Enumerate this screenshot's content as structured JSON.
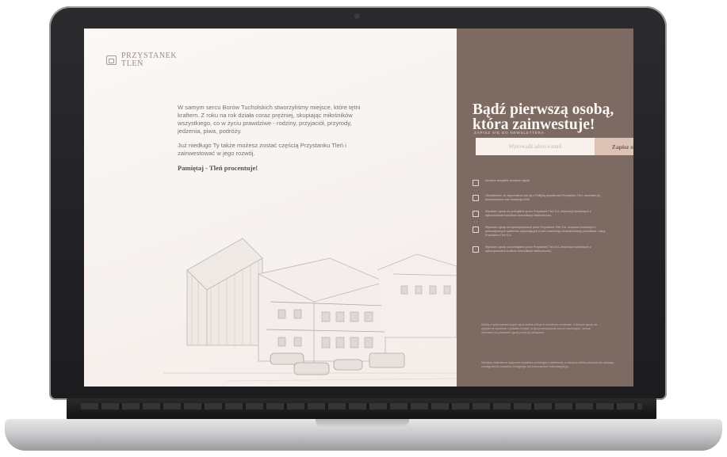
{
  "brand": {
    "name_line1": "PRZYSTANEK",
    "name_line2": "TLEŃ",
    "icon": "building-icon"
  },
  "intro": {
    "paragraph1": "W samym sercu Borów Tucholskich stworzyliśmy miejsce, które tętni kraftem. Z roku na rok działa coraz prężniej, skupiając miłośników wszystkiego, co w życiu prawdziwe - rodziny, przyjaciół, przyrody, jedzenia, piwa, podróży.",
    "paragraph2": "Już niedługo Ty także możesz zostać częścią Przystanku Tleń i zainwestować w jego rozwój.",
    "motto": "Pamiętaj - Tleń procentuje!"
  },
  "newsletter": {
    "headline_line1": "Bądź pierwszą osobą,",
    "headline_line2": "która zainwestuje!",
    "subheading": "ZAPISZ SIĘ DO NEWSLETTERA",
    "email_placeholder": "Wprowadź adres e-mail",
    "email_value": "",
    "submit_label": "Zapisz się!"
  },
  "consents": [
    {
      "text": "Zaznacz wszystkie poniższe zgody.",
      "checked": false
    },
    {
      "text": "Oświadczam, że zapoznałem/-am się z Polityką prywatności Przystanku Tleń, rozumiem jej postanowienia oraz akceptuję treść.",
      "checked": false
    },
    {
      "text": "Wyrażam zgodę na przesyłanie przez Przystanek Tleń S.A. informacji handlowych z wykorzystaniem środków komunikacji elektronicznej.",
      "checked": false
    },
    {
      "text": "Wyrażam zgodę na wykorzystywanie przez Przystanek Tleń S.A. urządzeń końcowych i automatycznych systemów wywołujących w celu marketingu bezpośredniego produktów i usług Przystanku Tleń S.A.",
      "checked": false
    },
    {
      "text": "Wyrażam zgodę na przesyłanie przez Przystanek Tleń S.A. informacji handlowych z wykorzystaniem środków komunikacji elektronicznej.",
      "checked": false
    }
  ],
  "notes": {
    "withdrawal": "Każdą z wyżej wymienionych zgód można cofnąć w dowolnym momencie. Cofnięcie zgody nie wpływa na zgodność z prawem działań, w tym przetwarzania danych osobowych, których dokonano na podstawie zgody przed jej cofnięciem.",
    "disclaimer": "Niniejszy materiał ma wyłącznie charakter promocyjny i reklamowy, a niniejsza oferta publiczna nie wymaga udostępnienia prospektu emisyjnego ani memorandum informacyjnego."
  },
  "colors": {
    "panel_right": "#7c6a63",
    "panel_left": "#f6f1ee",
    "button": "#dcc3b6"
  }
}
